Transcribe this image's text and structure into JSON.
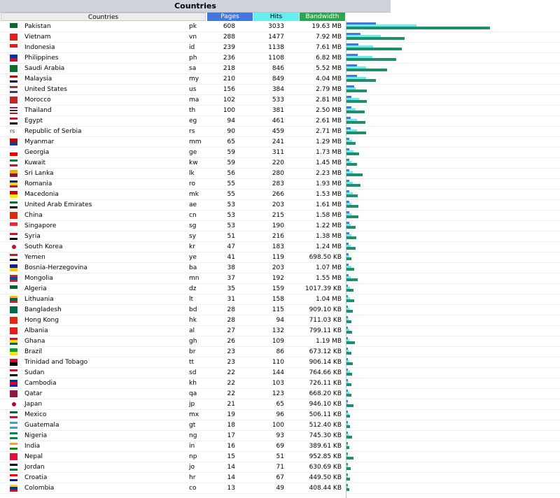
{
  "title": "Countries",
  "headers": {
    "countries": "Countries",
    "pages": "Pages",
    "hits": "Hits",
    "bandwidth": "Bandwidth"
  },
  "colors": {
    "pages": "#4477dd",
    "hits": "#66eeee",
    "bandwidth": "#2ea44f"
  },
  "rows": [
    {
      "name": "Pakistan",
      "code": "pk",
      "pages": 608,
      "hits": 3033,
      "bandwidth": "19.63 MB",
      "bw_mb": 19.63
    },
    {
      "name": "Vietnam",
      "code": "vn",
      "pages": 288,
      "hits": 1477,
      "bandwidth": "7.92 MB",
      "bw_mb": 7.92
    },
    {
      "name": "Indonesia",
      "code": "id",
      "pages": 239,
      "hits": 1138,
      "bandwidth": "7.61 MB",
      "bw_mb": 7.61
    },
    {
      "name": "Philippines",
      "code": "ph",
      "pages": 236,
      "hits": 1108,
      "bandwidth": "6.82 MB",
      "bw_mb": 6.82
    },
    {
      "name": "Saudi Arabia",
      "code": "sa",
      "pages": 218,
      "hits": 846,
      "bandwidth": "5.52 MB",
      "bw_mb": 5.52
    },
    {
      "name": "Malaysia",
      "code": "my",
      "pages": 210,
      "hits": 849,
      "bandwidth": "4.04 MB",
      "bw_mb": 4.04
    },
    {
      "name": "United States",
      "code": "us",
      "pages": 156,
      "hits": 384,
      "bandwidth": "2.79 MB",
      "bw_mb": 2.79
    },
    {
      "name": "Morocco",
      "code": "ma",
      "pages": 102,
      "hits": 533,
      "bandwidth": "2.81 MB",
      "bw_mb": 2.81
    },
    {
      "name": "Thailand",
      "code": "th",
      "pages": 100,
      "hits": 381,
      "bandwidth": "2.50 MB",
      "bw_mb": 2.5
    },
    {
      "name": "Egypt",
      "code": "eg",
      "pages": 94,
      "hits": 461,
      "bandwidth": "2.61 MB",
      "bw_mb": 2.61
    },
    {
      "name": "Republic of Serbia",
      "code": "rs",
      "pages": 90,
      "hits": 459,
      "bandwidth": "2.71 MB",
      "bw_mb": 2.71
    },
    {
      "name": "Myanmar",
      "code": "mm",
      "pages": 65,
      "hits": 241,
      "bandwidth": "1.29 MB",
      "bw_mb": 1.29
    },
    {
      "name": "Georgia",
      "code": "ge",
      "pages": 59,
      "hits": 311,
      "bandwidth": "1.73 MB",
      "bw_mb": 1.73
    },
    {
      "name": "Kuwait",
      "code": "kw",
      "pages": 59,
      "hits": 220,
      "bandwidth": "1.45 MB",
      "bw_mb": 1.45
    },
    {
      "name": "Sri Lanka",
      "code": "lk",
      "pages": 56,
      "hits": 280,
      "bandwidth": "2.23 MB",
      "bw_mb": 2.23
    },
    {
      "name": "Romania",
      "code": "ro",
      "pages": 55,
      "hits": 283,
      "bandwidth": "1.93 MB",
      "bw_mb": 1.93
    },
    {
      "name": "Macedonia",
      "code": "mk",
      "pages": 55,
      "hits": 266,
      "bandwidth": "1.53 MB",
      "bw_mb": 1.53
    },
    {
      "name": "United Arab Emirates",
      "code": "ae",
      "pages": 53,
      "hits": 203,
      "bandwidth": "1.61 MB",
      "bw_mb": 1.61
    },
    {
      "name": "China",
      "code": "cn",
      "pages": 53,
      "hits": 215,
      "bandwidth": "1.58 MB",
      "bw_mb": 1.58
    },
    {
      "name": "Singapore",
      "code": "sg",
      "pages": 53,
      "hits": 190,
      "bandwidth": "1.22 MB",
      "bw_mb": 1.22
    },
    {
      "name": "Syria",
      "code": "sy",
      "pages": 51,
      "hits": 216,
      "bandwidth": "1.38 MB",
      "bw_mb": 1.38
    },
    {
      "name": "South Korea",
      "code": "kr",
      "pages": 47,
      "hits": 183,
      "bandwidth": "1.24 MB",
      "bw_mb": 1.24
    },
    {
      "name": "Yemen",
      "code": "ye",
      "pages": 41,
      "hits": 119,
      "bandwidth": "698.50 KB",
      "bw_mb": 0.68
    },
    {
      "name": "Bosnia-Herzegovina",
      "code": "ba",
      "pages": 38,
      "hits": 203,
      "bandwidth": "1.07 MB",
      "bw_mb": 1.07
    },
    {
      "name": "Mongolia",
      "code": "mn",
      "pages": 37,
      "hits": 192,
      "bandwidth": "1.55 MB",
      "bw_mb": 1.55
    },
    {
      "name": "Algeria",
      "code": "dz",
      "pages": 35,
      "hits": 159,
      "bandwidth": "1017.39 KB",
      "bw_mb": 0.99
    },
    {
      "name": "Lithuania",
      "code": "lt",
      "pages": 31,
      "hits": 158,
      "bandwidth": "1.04 MB",
      "bw_mb": 1.04
    },
    {
      "name": "Bangladesh",
      "code": "bd",
      "pages": 28,
      "hits": 115,
      "bandwidth": "909.10 KB",
      "bw_mb": 0.89
    },
    {
      "name": "Hong Kong",
      "code": "hk",
      "pages": 28,
      "hits": 94,
      "bandwidth": "711.03 KB",
      "bw_mb": 0.69
    },
    {
      "name": "Albania",
      "code": "al",
      "pages": 27,
      "hits": 132,
      "bandwidth": "799.11 KB",
      "bw_mb": 0.78
    },
    {
      "name": "Ghana",
      "code": "gh",
      "pages": 26,
      "hits": 109,
      "bandwidth": "1.19 MB",
      "bw_mb": 1.19
    },
    {
      "name": "Brazil",
      "code": "br",
      "pages": 23,
      "hits": 86,
      "bandwidth": "673.12 KB",
      "bw_mb": 0.66
    },
    {
      "name": "Trinidad and Tobago",
      "code": "tt",
      "pages": 23,
      "hits": 110,
      "bandwidth": "906.14 KB",
      "bw_mb": 0.88
    },
    {
      "name": "Sudan",
      "code": "sd",
      "pages": 22,
      "hits": 144,
      "bandwidth": "764.66 KB",
      "bw_mb": 0.75
    },
    {
      "name": "Cambodia",
      "code": "kh",
      "pages": 22,
      "hits": 103,
      "bandwidth": "726.11 KB",
      "bw_mb": 0.71
    },
    {
      "name": "Qatar",
      "code": "qa",
      "pages": 22,
      "hits": 123,
      "bandwidth": "668.20 KB",
      "bw_mb": 0.65
    },
    {
      "name": "Japan",
      "code": "jp",
      "pages": 21,
      "hits": 65,
      "bandwidth": "946.10 KB",
      "bw_mb": 0.92
    },
    {
      "name": "Mexico",
      "code": "mx",
      "pages": 19,
      "hits": 96,
      "bandwidth": "506.11 KB",
      "bw_mb": 0.49
    },
    {
      "name": "Guatemala",
      "code": "gt",
      "pages": 18,
      "hits": 100,
      "bandwidth": "512.40 KB",
      "bw_mb": 0.5
    },
    {
      "name": "Nigeria",
      "code": "ng",
      "pages": 17,
      "hits": 93,
      "bandwidth": "745.30 KB",
      "bw_mb": 0.73
    },
    {
      "name": "India",
      "code": "in",
      "pages": 16,
      "hits": 69,
      "bandwidth": "389.61 KB",
      "bw_mb": 0.38
    },
    {
      "name": "Nepal",
      "code": "np",
      "pages": 15,
      "hits": 51,
      "bandwidth": "952.85 KB",
      "bw_mb": 0.93
    },
    {
      "name": "Jordan",
      "code": "jo",
      "pages": 14,
      "hits": 71,
      "bandwidth": "630.69 KB",
      "bw_mb": 0.62
    },
    {
      "name": "Croatia",
      "code": "hr",
      "pages": 14,
      "hits": 67,
      "bandwidth": "449.50 KB",
      "bw_mb": 0.44
    },
    {
      "name": "Colombia",
      "code": "co",
      "pages": 13,
      "hits": 49,
      "bandwidth": "408.44 KB",
      "bw_mb": 0.4
    }
  ]
}
